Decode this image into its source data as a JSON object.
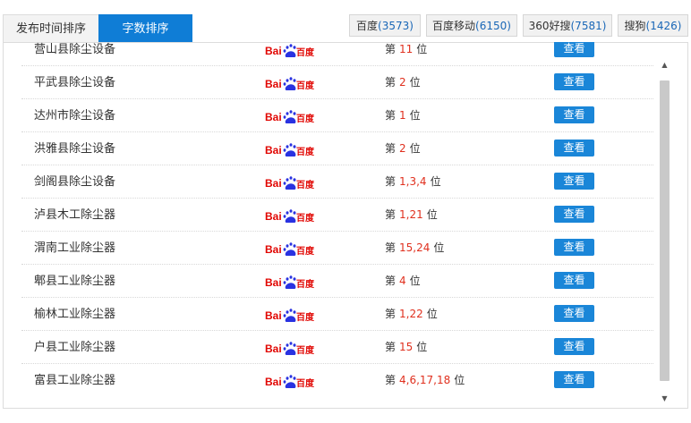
{
  "tabs": {
    "time_sort": "发布时间排序",
    "count_sort": "字数排序"
  },
  "engines": [
    {
      "name": "百度",
      "count": "(3573)"
    },
    {
      "name": "百度移动",
      "count": "(6150)"
    },
    {
      "name": "360好搜",
      "count": "(7581)"
    },
    {
      "name": "搜狗",
      "count": "(1426)"
    }
  ],
  "rank_prefix": "第",
  "rank_suffix": "位",
  "view_label": "查看",
  "logo_text": {
    "bai": "Bai",
    "du": "百度"
  },
  "rows": [
    {
      "keyword": "营山县除尘设备",
      "rank": "11"
    },
    {
      "keyword": "平武县除尘设备",
      "rank": "2"
    },
    {
      "keyword": "达州市除尘设备",
      "rank": "1"
    },
    {
      "keyword": "洪雅县除尘设备",
      "rank": "2"
    },
    {
      "keyword": "剑阁县除尘设备",
      "rank": "1,3,4"
    },
    {
      "keyword": "泸县木工除尘器",
      "rank": "1,21"
    },
    {
      "keyword": "渭南工业除尘器",
      "rank": "15,24"
    },
    {
      "keyword": "郫县工业除尘器",
      "rank": "4"
    },
    {
      "keyword": "榆林工业除尘器",
      "rank": "1,22"
    },
    {
      "keyword": "户县工业除尘器",
      "rank": "15"
    },
    {
      "keyword": "富县工业除尘器",
      "rank": "4,6,17,18"
    }
  ],
  "colors": {
    "accent": "#0f7dd6",
    "button": "#1a86d8",
    "rank": "#e0301e",
    "count": "#1a67b7",
    "baidu_red": "#e10602",
    "baidu_blue": "#2932e1"
  }
}
